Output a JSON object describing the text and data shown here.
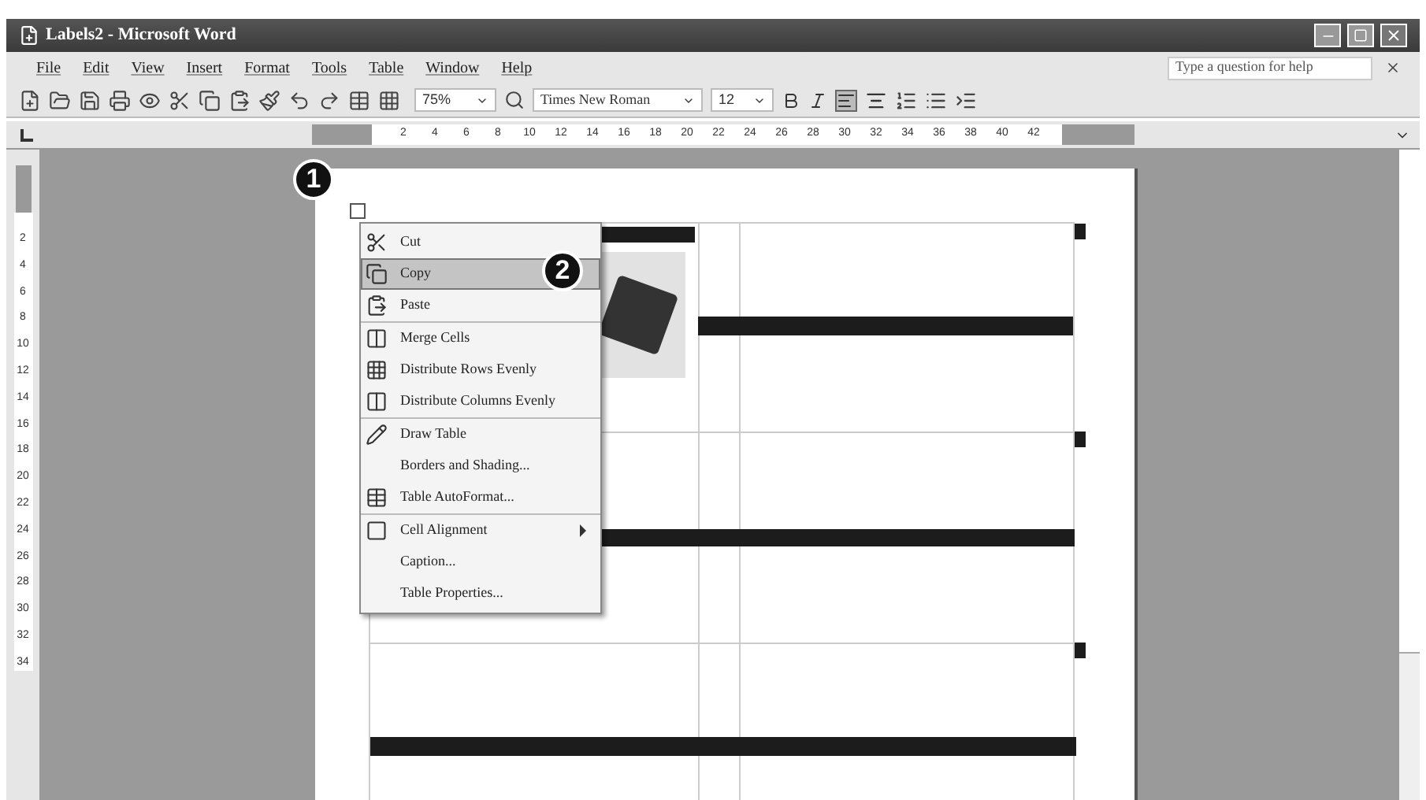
{
  "window": {
    "title": "Labels2 - Microsoft Word"
  },
  "menu_bar": [
    {
      "label": "File"
    },
    {
      "label": "Edit"
    },
    {
      "label": "View"
    },
    {
      "label": "Insert"
    },
    {
      "label": "Format"
    },
    {
      "label": "Tools"
    },
    {
      "label": "Table"
    },
    {
      "label": "Window"
    },
    {
      "label": "Help"
    }
  ],
  "help_box": {
    "placeholder": "Type a question for help"
  },
  "toolbar": {
    "zoom": "75%",
    "font": "Times New Roman",
    "size": "12"
  },
  "ruler": {
    "numbers": [
      "2",
      "4",
      "6",
      "8",
      "10",
      "12",
      "14",
      "16",
      "18",
      "20",
      "22",
      "24",
      "26",
      "28",
      "30",
      "32",
      "34",
      "36",
      "38",
      "40",
      "42"
    ]
  },
  "vertical_ruler": {
    "numbers": [
      "2",
      "4",
      "6",
      "8",
      "10",
      "12",
      "14",
      "16",
      "18",
      "20",
      "22",
      "24",
      "26",
      "28",
      "30",
      "32",
      "34"
    ]
  },
  "callouts": [
    "1",
    "2"
  ],
  "context_menu": [
    {
      "label": "Cut",
      "selected": false,
      "submenu": false,
      "separator_after": false
    },
    {
      "label": "Copy",
      "selected": true,
      "submenu": false,
      "separator_after": false
    },
    {
      "label": "Paste",
      "selected": false,
      "submenu": false,
      "separator_after": true
    },
    {
      "label": "Merge Cells",
      "selected": false,
      "submenu": false,
      "separator_after": false
    },
    {
      "label": "Distribute Rows Evenly",
      "selected": false,
      "submenu": false,
      "separator_after": false
    },
    {
      "label": "Distribute Columns Evenly",
      "selected": false,
      "submenu": false,
      "separator_after": true
    },
    {
      "label": "Draw Table",
      "selected": false,
      "submenu": false,
      "separator_after": false
    },
    {
      "label": "Borders and Shading...",
      "selected": false,
      "submenu": false,
      "separator_after": false
    },
    {
      "label": "Table AutoFormat...",
      "selected": false,
      "submenu": false,
      "separator_after": true
    },
    {
      "label": "Cell Alignment",
      "selected": false,
      "submenu": true,
      "separator_after": false
    },
    {
      "label": "Caption...",
      "selected": false,
      "submenu": false,
      "separator_after": false
    },
    {
      "label": "Table Properties...",
      "selected": false,
      "submenu": false,
      "separator_after": false
    }
  ]
}
